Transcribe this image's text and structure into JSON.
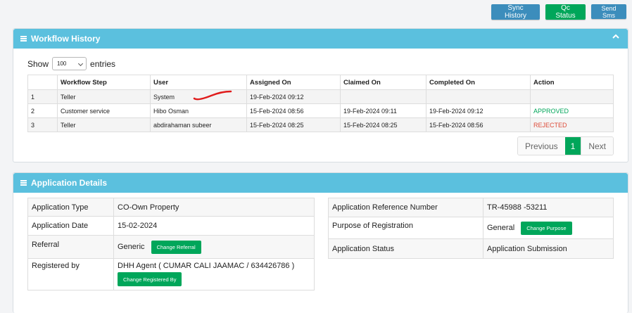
{
  "topbar": {
    "sync_history": "Sync History",
    "qc_status": "Qc Status",
    "send_sms": "Send Sms"
  },
  "workflow": {
    "title": "Workflow History",
    "show_label": "Show",
    "entries_value": "100",
    "entries_label": "entries",
    "columns": [
      "",
      "Workflow Step",
      "User",
      "Assigned On",
      "Claimed On",
      "Completed On",
      "Action"
    ],
    "rows": [
      {
        "no": "1",
        "step": "Teller",
        "user": "System",
        "assigned": "19-Feb-2024 09:12",
        "claimed": "",
        "completed": "",
        "action": ""
      },
      {
        "no": "2",
        "step": "Customer service",
        "user": "Hibo Osman",
        "assigned": "15-Feb-2024 08:56",
        "claimed": "19-Feb-2024 09:11",
        "completed": "19-Feb-2024 09:12",
        "action": "APPROVED"
      },
      {
        "no": "3",
        "step": "Teller",
        "user": "abdirahaman subeer",
        "assigned": "15-Feb-2024 08:25",
        "claimed": "15-Feb-2024 08:25",
        "completed": "15-Feb-2024 08:56",
        "action": "REJECTED"
      }
    ],
    "pager": {
      "previous": "Previous",
      "current": "1",
      "next": "Next"
    }
  },
  "details": {
    "title": "Application Details",
    "left": {
      "type_label": "Application Type",
      "type_value": "CO-Own Property",
      "date_label": "Application Date",
      "date_value": "15-02-2024",
      "referral_label": "Referral",
      "referral_value": "Generic",
      "change_referral": "Change Referral",
      "registered_label": "Registered by",
      "registered_value": "DHH Agent ( CUMAR CALI JAAMAC / 634426786 )",
      "change_registered": "Change Registered By"
    },
    "right": {
      "ref_label": "Application Reference Number",
      "ref_value": "TR-45988 -53211",
      "purpose_label": "Purpose of Registration",
      "purpose_value": "General",
      "change_purpose": "Change Purpose",
      "status_label": "Application Status",
      "status_value": "Application Submission"
    }
  },
  "colors": {
    "header": "#5bc0de",
    "green": "#00a65a",
    "blue": "#3c8dbc",
    "red": "#dd4b39",
    "annotation": "#e01c1c"
  }
}
